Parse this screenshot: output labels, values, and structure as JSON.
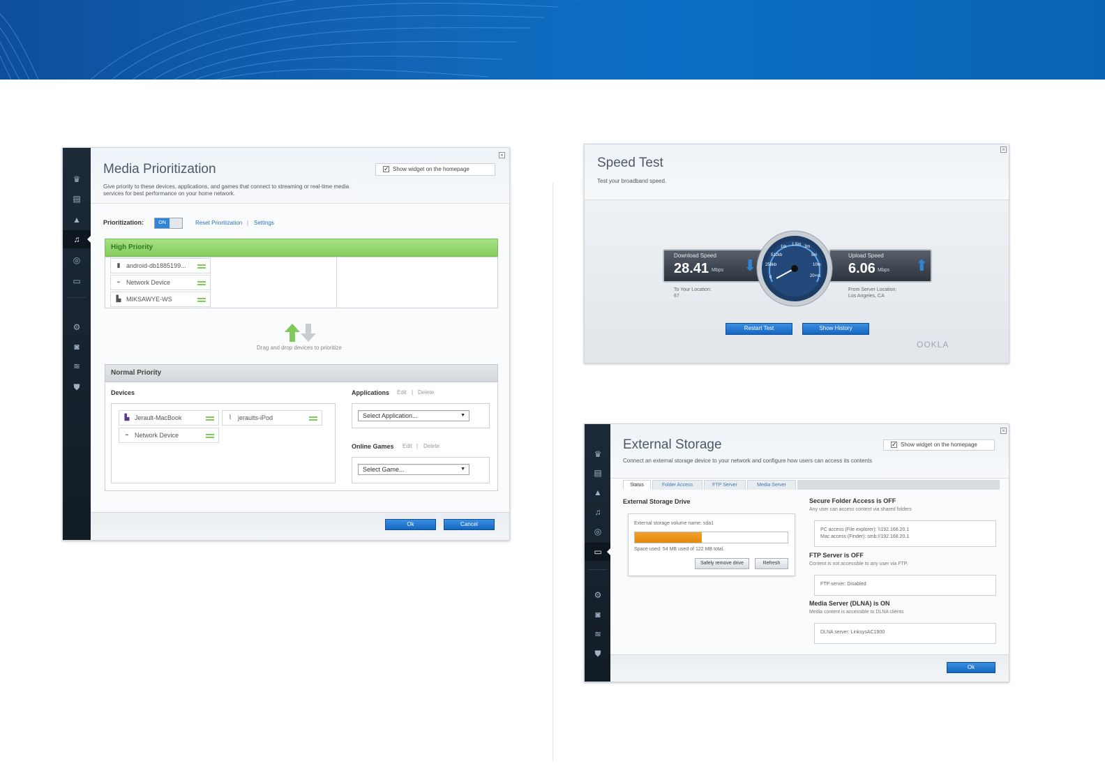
{
  "media": {
    "title": "Media Prioritization",
    "description": "Give priority to these devices, applications, and games that connect to streaming or real-time media services for best performance on your home network.",
    "widget_label": "Show widget on the homepage",
    "prioritization_label": "Prioritization:",
    "toggle_label": "ON",
    "reset_link": "Reset Prioritization",
    "link_separator": "|",
    "settings_link": "Settings",
    "high_priority_label": "High Priority",
    "high_devices": [
      "android-db1885199...",
      "Network Device",
      "MIKSAWYE-WS"
    ],
    "drag_hint": "Drag and drop devices to prioritize",
    "normal_priority_label": "Normal Priority",
    "devices_label": "Devices",
    "normal_devices": [
      "Jerault-MacBook",
      "jeraults-iPod",
      "Network Device"
    ],
    "applications_label": "Applications",
    "edit_link": "Edit",
    "delete_link": "Delete",
    "select_application": "Select Application...",
    "online_games_label": "Online Games",
    "select_game": "Select Game...",
    "ok_label": "Ok",
    "cancel_label": "Cancel"
  },
  "speedtest": {
    "title": "Speed Test",
    "subtitle": "Test your broadband speed.",
    "download_label": "Download Speed",
    "download_value": "28.41",
    "unit": "Mbps",
    "download_location_label": "To Your Location:",
    "download_location_value": "67",
    "upload_label": "Upload Speed",
    "upload_value": "6.06",
    "upload_location_label": "From Server Location:",
    "upload_location_value": "Los Angeles, CA",
    "gauge_ticks": [
      "1m",
      "1.5m",
      "3m",
      "512kb",
      "5m",
      "256kb",
      "10m",
      "0",
      "20+m"
    ],
    "restart_label": "Restart Test",
    "history_label": "Show History",
    "brand": "OOKLA"
  },
  "storage": {
    "title": "External Storage",
    "description": "Connect an external storage device to your network and configure how users can access its contents",
    "widget_label": "Show widget on the homepage",
    "tabs": [
      "Status",
      "Folder Access",
      "FTP Server",
      "Media Server"
    ],
    "drive_label": "External Storage Drive",
    "volume_label": "External storage volume name: sda1",
    "space_label": "Space used: 54 MB used of 122 MB total.",
    "usage_fraction": 0.44,
    "remove_label": "Safely remove drive",
    "refresh_label": "Refresh",
    "secure_title": "Secure Folder Access is OFF",
    "secure_text": "Any user can access content via shared folders",
    "pc_access": "PC access (File explorer): \\\\192.168.20.1",
    "mac_access": "Mac access (Finder): smb://192.168.20.1",
    "ftp_title": "FTP Server is OFF",
    "ftp_text": "Content is not accessible to any user via FTP.",
    "ftp_status": "FTP server: Disabled",
    "dlna_title": "Media Server (DLNA) is ON",
    "dlna_text": "Media content is accessible to DLNA clients",
    "dlna_status": "DLNA server: LinksysAC1900",
    "ok_label": "Ok"
  },
  "colors": {
    "accent_blue": "#1566c0",
    "high_priority_green": "#8fd36a",
    "usage_orange": "#e48a0c",
    "sidebar_dark": "#1c2a38"
  }
}
